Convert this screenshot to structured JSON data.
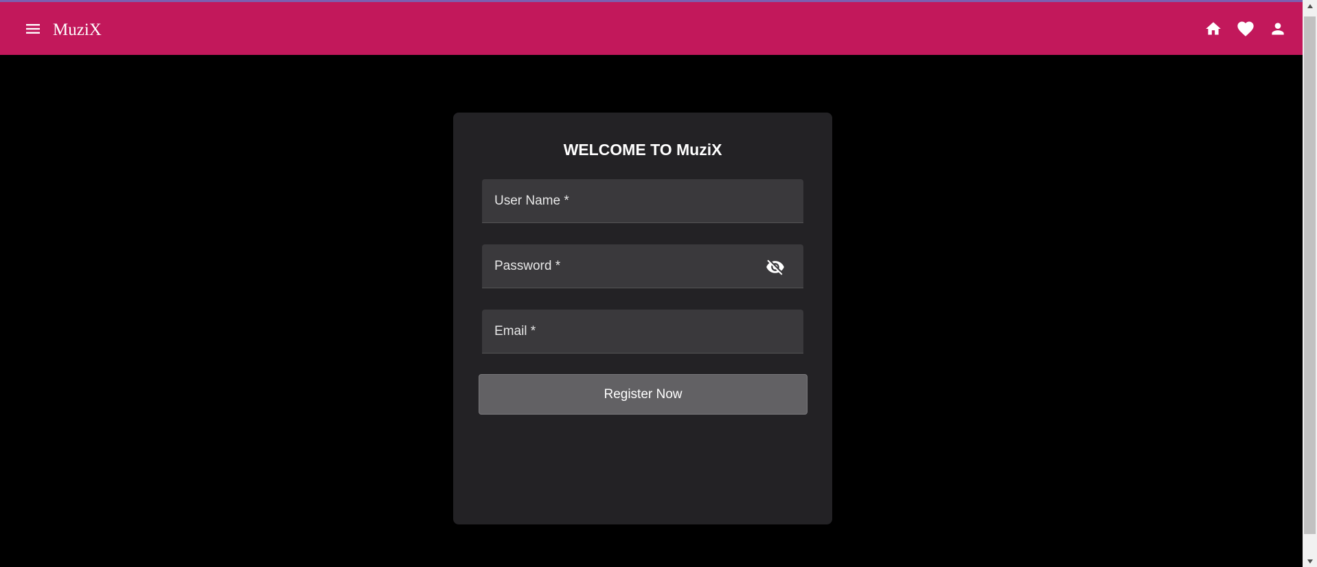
{
  "header": {
    "title": "MuziX",
    "menu_icon": "menu-icon",
    "actions": [
      {
        "icon": "home-icon",
        "label": "Home"
      },
      {
        "icon": "heart-icon",
        "label": "Favourites"
      },
      {
        "icon": "person-icon",
        "label": "Account"
      }
    ]
  },
  "form": {
    "title": "WELCOME TO MuziX",
    "username": {
      "placeholder": "User Name *",
      "value": ""
    },
    "password": {
      "placeholder": "Password *",
      "value": "",
      "toggle_icon": "visibility-off-icon"
    },
    "email": {
      "placeholder": "Email *",
      "value": ""
    },
    "submit_label": "Register Now"
  },
  "colors": {
    "toolbar": "#c2185b",
    "background": "#000000",
    "card": "#232225",
    "field": "#3a393c",
    "button": "#626164"
  }
}
